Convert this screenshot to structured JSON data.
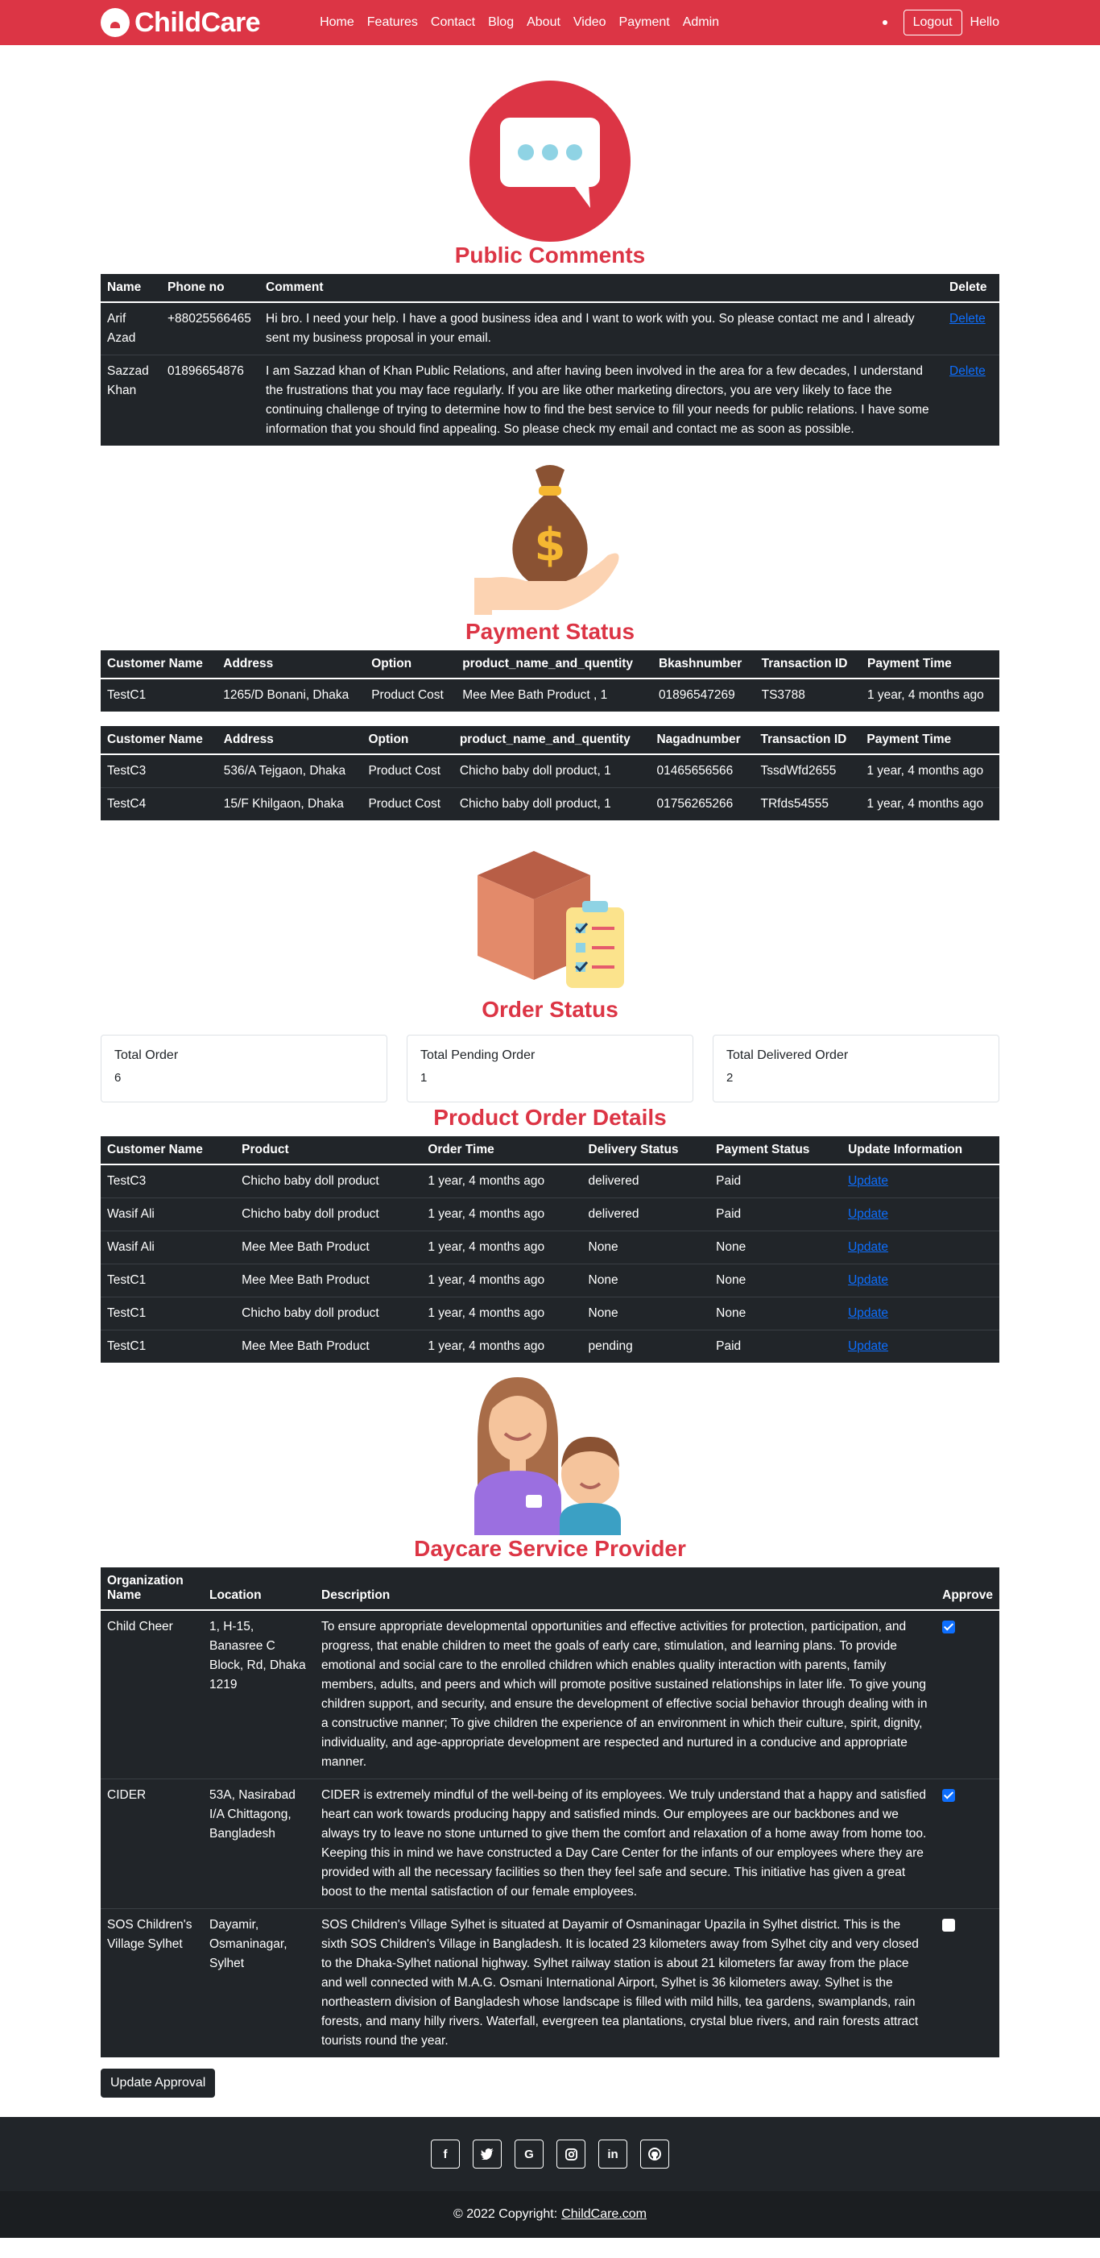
{
  "nav": {
    "brand": "ChildCare",
    "links": [
      "Home",
      "Features",
      "Contact",
      "Blog",
      "About",
      "Video",
      "Payment",
      "Admin"
    ],
    "logout": "Logout",
    "greeting": "Hello"
  },
  "comments": {
    "title": "Public Comments",
    "headers": [
      "Name",
      "Phone no",
      "Comment",
      "Delete"
    ],
    "rows": [
      {
        "name": "Arif Azad",
        "phone": "+88025566465",
        "comment": "Hi bro. I need your help. I have a good business idea and I want to work with you. So please contact me and I already sent my business proposal in your email.",
        "action": "Delete"
      },
      {
        "name": "Sazzad Khan",
        "phone": "01896654876",
        "comment": "I am Sazzad khan of Khan Public Relations, and after having been involved in the area for a few decades, I understand the frustrations that you may face regularly. If you are like other marketing directors, you are very likely to face the continuing challenge of trying to determine how to find the best service to fill your needs for public relations. I have some information that you should find appealing. So please check my email and contact me as soon as possible.",
        "action": "Delete"
      }
    ]
  },
  "payment": {
    "title": "Payment Status",
    "bkash": {
      "headers": [
        "Customer Name",
        "Address",
        "Option",
        "product_name_and_quentity",
        "Bkashnumber",
        "Transaction ID",
        "Payment Time"
      ],
      "rows": [
        [
          "TestC1",
          "1265/D Bonani, Dhaka",
          "Product Cost",
          "Mee Mee Bath Product , 1",
          "01896547269",
          "TS3788",
          "1 year, 4 months ago"
        ]
      ]
    },
    "nagad": {
      "headers": [
        "Customer Name",
        "Address",
        "Option",
        "product_name_and_quentity",
        "Nagadnumber",
        "Transaction ID",
        "Payment Time"
      ],
      "rows": [
        [
          "TestC3",
          "536/A Tejgaon, Dhaka",
          "Product Cost",
          "Chicho baby doll product, 1",
          "01465656566",
          "TssdWfd2655",
          "1 year, 4 months ago"
        ],
        [
          "TestC4",
          "15/F Khilgaon, Dhaka",
          "Product Cost",
          "Chicho baby doll product, 1",
          "01756265266",
          "TRfds54555",
          "1 year, 4 months ago"
        ]
      ]
    }
  },
  "orders": {
    "title": "Order Status",
    "cards": [
      {
        "label": "Total Order",
        "value": "6"
      },
      {
        "label": "Total Pending Order",
        "value": "1"
      },
      {
        "label": "Total Delivered Order",
        "value": "2"
      }
    ],
    "details_title": "Product Order Details",
    "headers": [
      "Customer Name",
      "Product",
      "Order Time",
      "Delivery Status",
      "Payment Status",
      "Update Information"
    ],
    "rows": [
      [
        "TestC3",
        "Chicho baby doll product",
        "1 year, 4 months ago",
        "delivered",
        "Paid",
        "Update"
      ],
      [
        "Wasif Ali",
        "Chicho baby doll product",
        "1 year, 4 months ago",
        "delivered",
        "Paid",
        "Update"
      ],
      [
        "Wasif Ali",
        "Mee Mee Bath Product",
        "1 year, 4 months ago",
        "None",
        "None",
        "Update"
      ],
      [
        "TestC1",
        "Mee Mee Bath Product",
        "1 year, 4 months ago",
        "None",
        "None",
        "Update"
      ],
      [
        "TestC1",
        "Chicho baby doll product",
        "1 year, 4 months ago",
        "None",
        "None",
        "Update"
      ],
      [
        "TestC1",
        "Mee Mee Bath Product",
        "1 year, 4 months ago",
        "pending",
        "Paid",
        "Update"
      ]
    ]
  },
  "providers": {
    "title": "Daycare Service Provider",
    "headers": [
      "Organization Name",
      "Location",
      "Description",
      "Approve"
    ],
    "rows": [
      {
        "name": "Child Cheer",
        "location": "1, H-15, Banasree C Block, Rd, Dhaka 1219",
        "description": "To ensure appropriate developmental opportunities and effective activities for protection, participation, and progress, that enable children to meet the goals of early care, stimulation, and learning plans. To provide emotional and social care to the enrolled children which enables quality interaction with parents, family members, adults, and peers and which will promote positive sustained relationships in later life. To give young children support, and security, and ensure the development of effective social behavior through dealing with in a constructive manner; To give children the experience of an environment in which their culture, spirit, dignity, individuality, and age-appropriate development are respected and nurtured in a conducive and appropriate manner.",
        "approved": true
      },
      {
        "name": "CIDER",
        "location": "53A, Nasirabad I/A Chittagong, Bangladesh",
        "description": "CIDER is extremely mindful of the well-being of its employees. We truly understand that a happy and satisfied heart can work towards producing happy and satisfied minds. Our employees are our backbones and we always try to leave no stone unturned to give them the comfort and relaxation of a home away from home too. Keeping this in mind we have constructed a Day Care Center for the infants of our employees where they are provided with all the necessary facilities so then they feel safe and secure. This initiative has given a great boost to the mental satisfaction of our female employees.",
        "approved": true
      },
      {
        "name": "SOS Children's Village Sylhet",
        "location": "Dayamir, Osmaninagar, Sylhet",
        "description": "SOS Children's Village Sylhet is situated at Dayamir of Osmaninagar Upazila in Sylhet district. This is the sixth SOS Children's Village in Bangladesh. It is located 23 kilometers away from Sylhet city and very closed to the Dhaka-Sylhet national highway. Sylhet railway station is about 21 kilometers far away from the place and well connected with M.A.G. Osmani International Airport, Sylhet is 36 kilometers away. Sylhet is the northeastern division of Bangladesh whose landscape is filled with mild hills, tea gardens, swamplands, rain forests, and many hilly rivers. Waterfall, evergreen tea plantations, crystal blue rivers, and rain forests attract tourists round the year.",
        "approved": false
      }
    ],
    "button": "Update Approval"
  },
  "footer": {
    "social": [
      "facebook-icon",
      "twitter-icon",
      "google-icon",
      "instagram-icon",
      "linkedin-icon",
      "github-icon"
    ],
    "copyright": "© 2022 Copyright:",
    "link": "ChildCare.com"
  },
  "colors": {
    "brand": "#dc3545",
    "dark": "#212529",
    "link": "#0d6efd"
  }
}
